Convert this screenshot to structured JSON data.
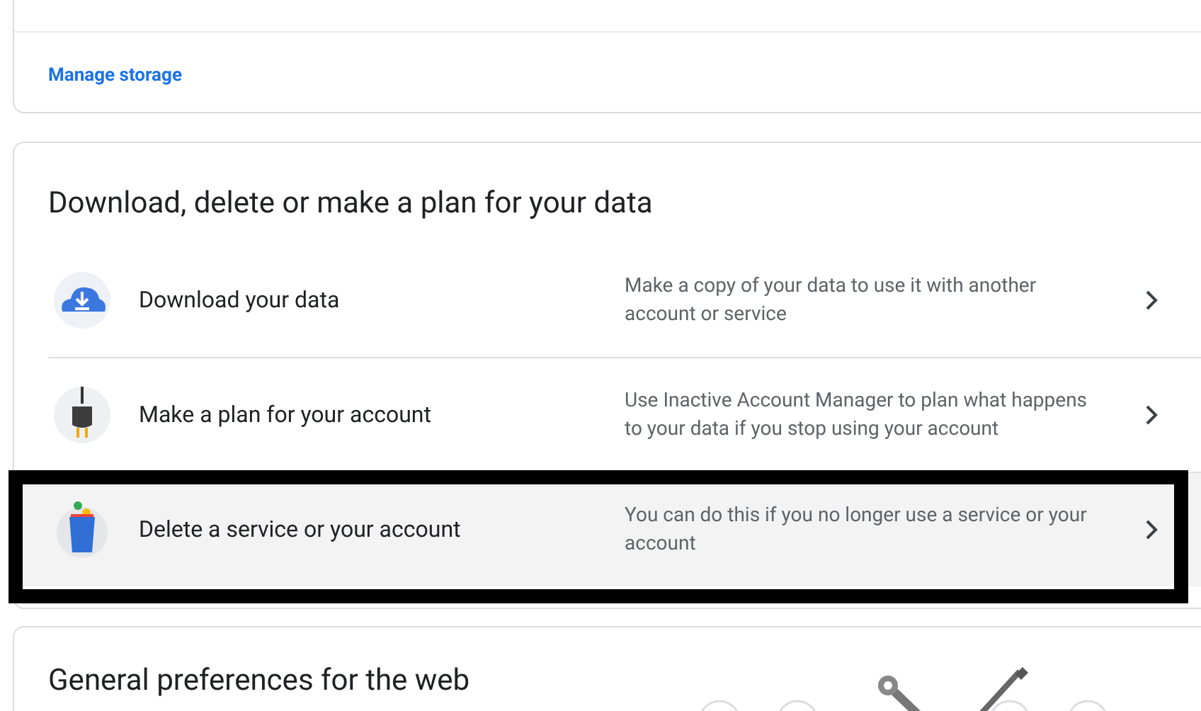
{
  "storage_card": {
    "link": "Manage storage"
  },
  "data_card": {
    "title": "Download, delete or make a plan for your data",
    "rows": [
      {
        "kind": "download",
        "title": "Download your data",
        "description": "Make a copy of your data to use it with another account or service",
        "highlighted": false
      },
      {
        "kind": "plan",
        "title": "Make a plan for your account",
        "description": "Use Inactive Account Manager to plan what happens to your data if you stop using your account",
        "highlighted": false
      },
      {
        "kind": "delete",
        "title": "Delete a service or your account",
        "description": "You can do this if you no longer use a service or your account",
        "highlighted": true
      }
    ]
  },
  "preferences_card": {
    "title": "General preferences for the web"
  }
}
